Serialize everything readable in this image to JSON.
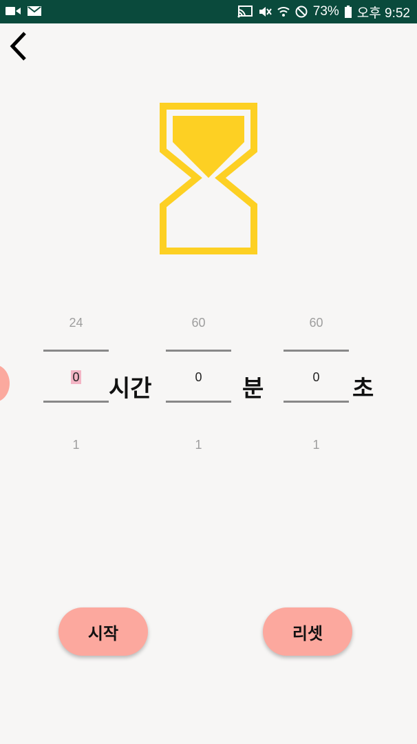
{
  "status_bar": {
    "battery": "73%",
    "time": "오후 9:52",
    "icons": [
      "video-icon",
      "gmail-icon",
      "cast-icon",
      "mute-icon",
      "wifi-icon",
      "no-disturb-icon",
      "battery-icon"
    ]
  },
  "colors": {
    "status_bar": "#0a4a3c",
    "background": "#f7f6f5",
    "hourglass": "#fdd023",
    "button": "#fca89e"
  },
  "picker": {
    "hours": {
      "above": "24",
      "value": "0",
      "below": "1",
      "unit": "시간"
    },
    "minutes": {
      "above": "60",
      "value": "0",
      "below": "1",
      "unit": "분"
    },
    "seconds": {
      "above": "60",
      "value": "0",
      "below": "1",
      "unit": "초"
    }
  },
  "buttons": {
    "start": "시작",
    "reset": "리셋"
  }
}
